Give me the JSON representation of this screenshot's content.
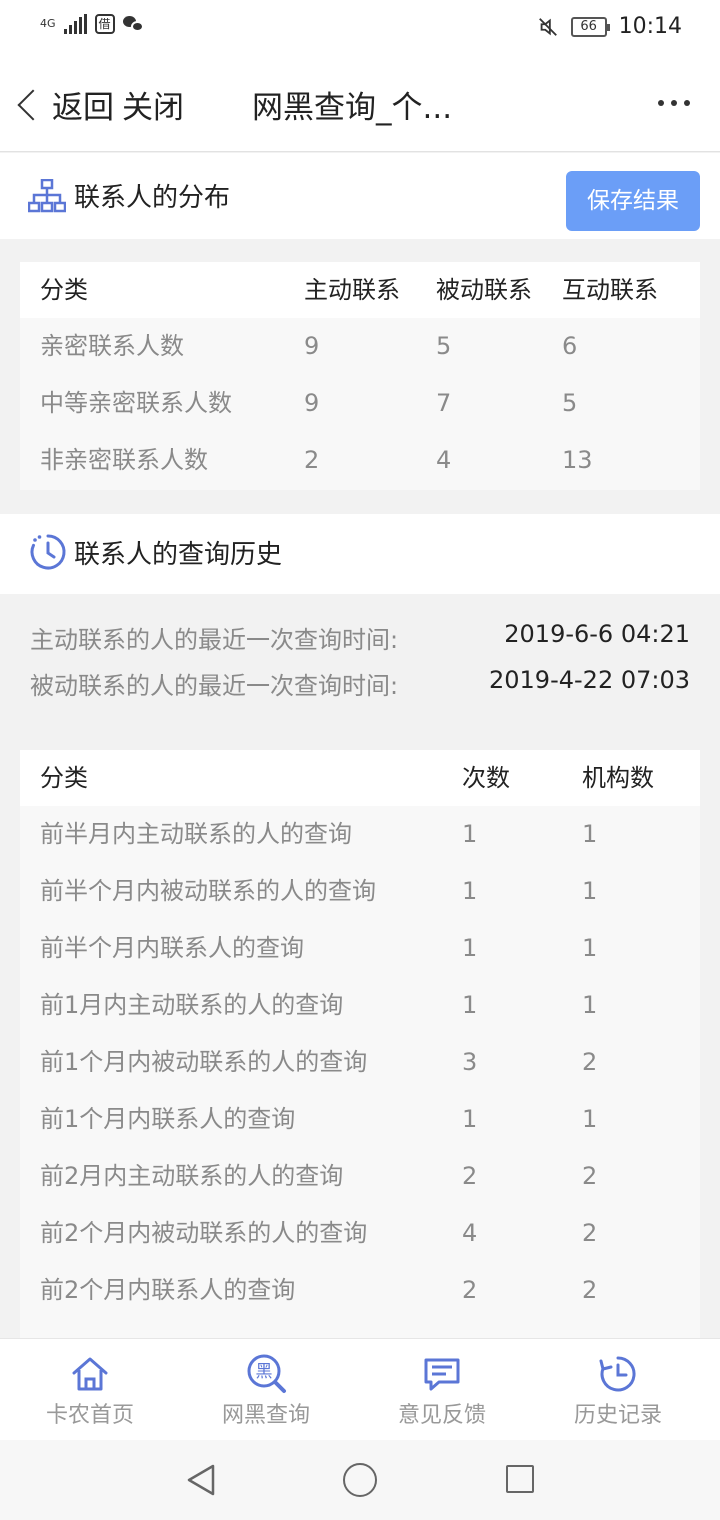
{
  "status_bar": {
    "network": "4G",
    "app_icon_char": "借",
    "battery": "66",
    "time": "10:14"
  },
  "header": {
    "back_label": "返回",
    "close_label": "关闭",
    "title": "网黑查询_个...",
    "more_icon": "more-dots-icon"
  },
  "distribution": {
    "title": "联系人的分布",
    "icon": "org-chart-icon",
    "save_label": "保存结果",
    "columns": [
      "分类",
      "主动联系",
      "被动联系",
      "互动联系"
    ],
    "rows": [
      [
        "亲密联系人数",
        "9",
        "5",
        "6"
      ],
      [
        "中等亲密联系人数",
        "9",
        "7",
        "5"
      ],
      [
        "非亲密联系人数",
        "2",
        "4",
        "13"
      ]
    ]
  },
  "history": {
    "title": "联系人的查询历史",
    "icon": "clock-history-icon",
    "active_label": "主动联系的人的最近一次查询时间:",
    "active_value": "2019-6-6 04:21",
    "passive_label": "被动联系的人的最近一次查询时间:",
    "passive_value": "2019-4-22 07:03",
    "columns": [
      "分类",
      "次数",
      "机构数"
    ],
    "rows": [
      [
        "前半月内主动联系的人的查询",
        "1",
        "1"
      ],
      [
        "前半个月内被动联系的人的查询",
        "1",
        "1"
      ],
      [
        "前半个月内联系人的查询",
        "1",
        "1"
      ],
      [
        "前1月内主动联系的人的查询",
        "1",
        "1"
      ],
      [
        "前1个月内被动联系的人的查询",
        "3",
        "2"
      ],
      [
        "前1个月内联系人的查询",
        "1",
        "1"
      ],
      [
        "前2月内主动联系的人的查询",
        "2",
        "2"
      ],
      [
        "前2个月内被动联系的人的查询",
        "4",
        "2"
      ],
      [
        "前2个月内联系人的查询",
        "2",
        "2"
      ]
    ]
  },
  "bottom_nav": [
    {
      "label": "卡农首页",
      "icon": "home-icon"
    },
    {
      "label": "网黑查询",
      "icon": "blacklist-search-icon",
      "icon_char": "黑"
    },
    {
      "label": "意见反馈",
      "icon": "feedback-icon"
    },
    {
      "label": "历史记录",
      "icon": "history-icon"
    }
  ],
  "colors": {
    "accent": "#6b9ef7",
    "nav_icon": "#5b76d6"
  }
}
